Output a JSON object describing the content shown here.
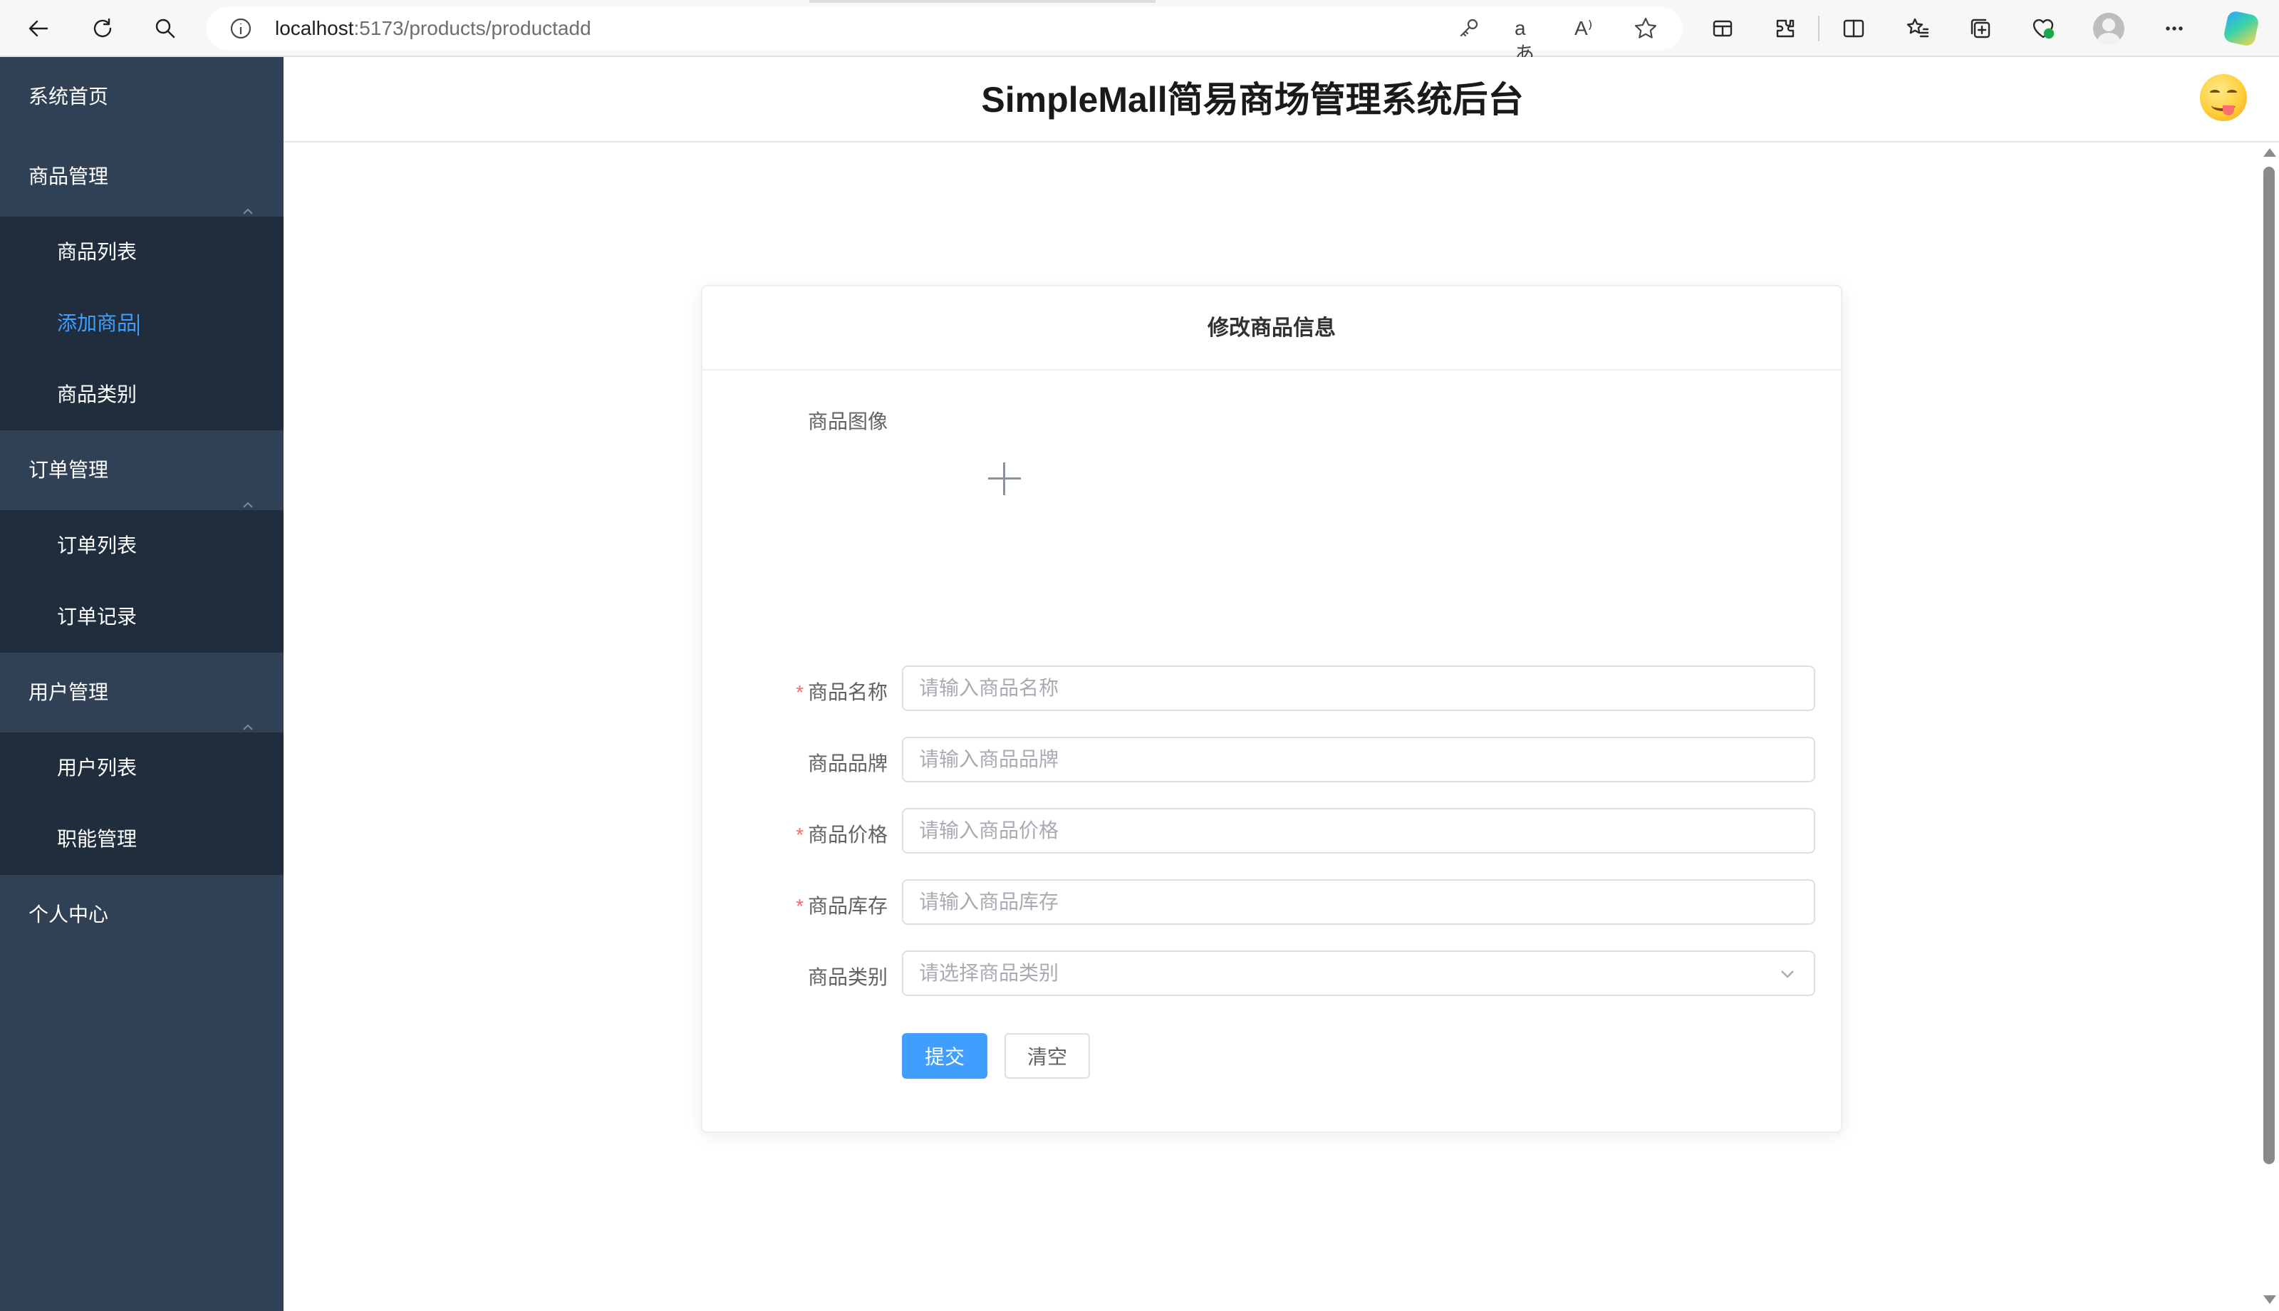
{
  "browser": {
    "url_host": "localhost",
    "url_rest": ":5173/products/productadd",
    "translate_glyph": "aあ",
    "read_aloud_glyph": "A⁾"
  },
  "sidebar": {
    "groups": [
      {
        "title": "系统首页"
      },
      {
        "title": "商品管理",
        "expanded": true,
        "items": [
          "商品列表",
          "添加商品",
          "商品类别"
        ],
        "active_index": 1
      },
      {
        "title": "订单管理",
        "expanded": true,
        "items": [
          "订单列表",
          "订单记录"
        ]
      },
      {
        "title": "用户管理",
        "expanded": true,
        "items": [
          "用户列表",
          "职能管理"
        ]
      },
      {
        "title": "个人中心"
      }
    ],
    "active_color": "#409eff",
    "background": "#304156",
    "submenu_background": "#1f2d3d"
  },
  "header": {
    "title": "SimpleMall简易商场管理系统后台"
  },
  "form": {
    "card_title": "修改商品信息",
    "image_label": "商品图像",
    "fields": [
      {
        "label": "商品名称",
        "required": true,
        "placeholder": "请输入商品名称",
        "value": ""
      },
      {
        "label": "商品品牌",
        "required": false,
        "placeholder": "请输入商品品牌",
        "value": ""
      },
      {
        "label": "商品价格",
        "required": true,
        "placeholder": "请输入商品价格",
        "value": ""
      },
      {
        "label": "商品库存",
        "required": true,
        "placeholder": "请输入商品库存",
        "value": ""
      }
    ],
    "category": {
      "label": "商品类别",
      "required": false,
      "placeholder": "请选择商品类别",
      "value": ""
    },
    "required_mark": "*",
    "submit_label": "提交",
    "clear_label": "清空",
    "primary_color": "#409eff",
    "required_color": "#f56c6c"
  },
  "icons": [
    "back-arrow-icon",
    "reload-icon",
    "search-icon",
    "site-info-icon",
    "key-icon",
    "translate-icon",
    "read-aloud-icon",
    "favorite-star-icon",
    "extensions-icon",
    "split-screen-icon",
    "favorites-icon",
    "collections-icon",
    "browser-essentials-icon",
    "more-icon",
    "copilot-icon",
    "chevron-up-icon",
    "plus-icon",
    "chevron-down-icon"
  ]
}
